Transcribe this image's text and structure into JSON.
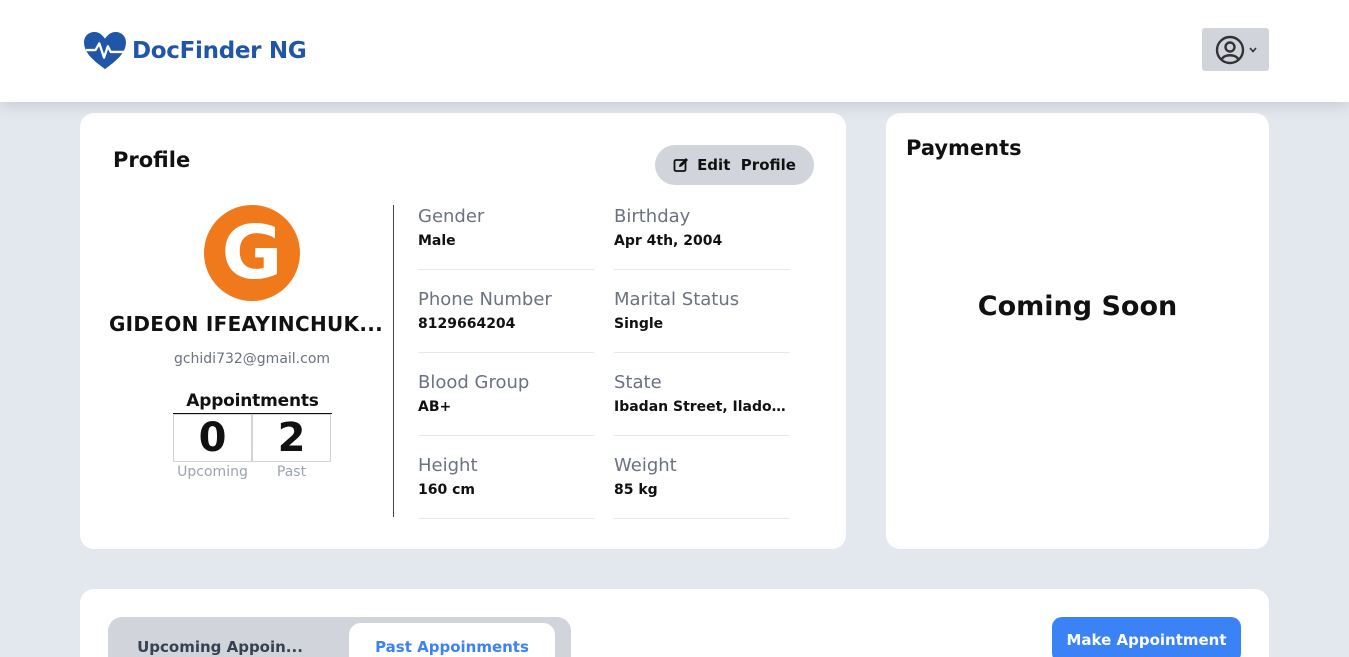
{
  "header": {
    "brand": "DocFinder NG",
    "brand_color": "#1f56a8"
  },
  "profile": {
    "title": "Profile",
    "edit_label": "Edit  Profile",
    "avatar_letter": "G",
    "avatar_color": "#f07a1b",
    "name": "GIDEON IFEAYINCHUK...",
    "email": "gchidi732@gmail.com",
    "appointments": {
      "title": "Appointments",
      "upcoming_count": "0",
      "past_count": "2",
      "upcoming_label": "Upcoming",
      "past_label": "Past"
    },
    "fields": {
      "gender": {
        "label": "Gender",
        "value": "Male"
      },
      "birthday": {
        "label": "Birthday",
        "value": "Apr 4th, 2004"
      },
      "phone": {
        "label": "Phone Number",
        "value": "8129664204"
      },
      "marital": {
        "label": "Marital Status",
        "value": "Single"
      },
      "blood": {
        "label": "Blood Group",
        "value": "AB+"
      },
      "state": {
        "label": "State",
        "value": "Ibadan Street, Ilado,..."
      },
      "height": {
        "label": "Height",
        "value": "160 cm"
      },
      "weight": {
        "label": "Weight",
        "value": "85 kg"
      }
    }
  },
  "payments": {
    "title": "Payments",
    "status": "Coming Soon"
  },
  "appointments_section": {
    "tab_upcoming": "Upcoming Appoin...",
    "tab_past": "Past Appoinments",
    "make_button": "Make Appointment",
    "accent_color": "#3b82f6"
  }
}
